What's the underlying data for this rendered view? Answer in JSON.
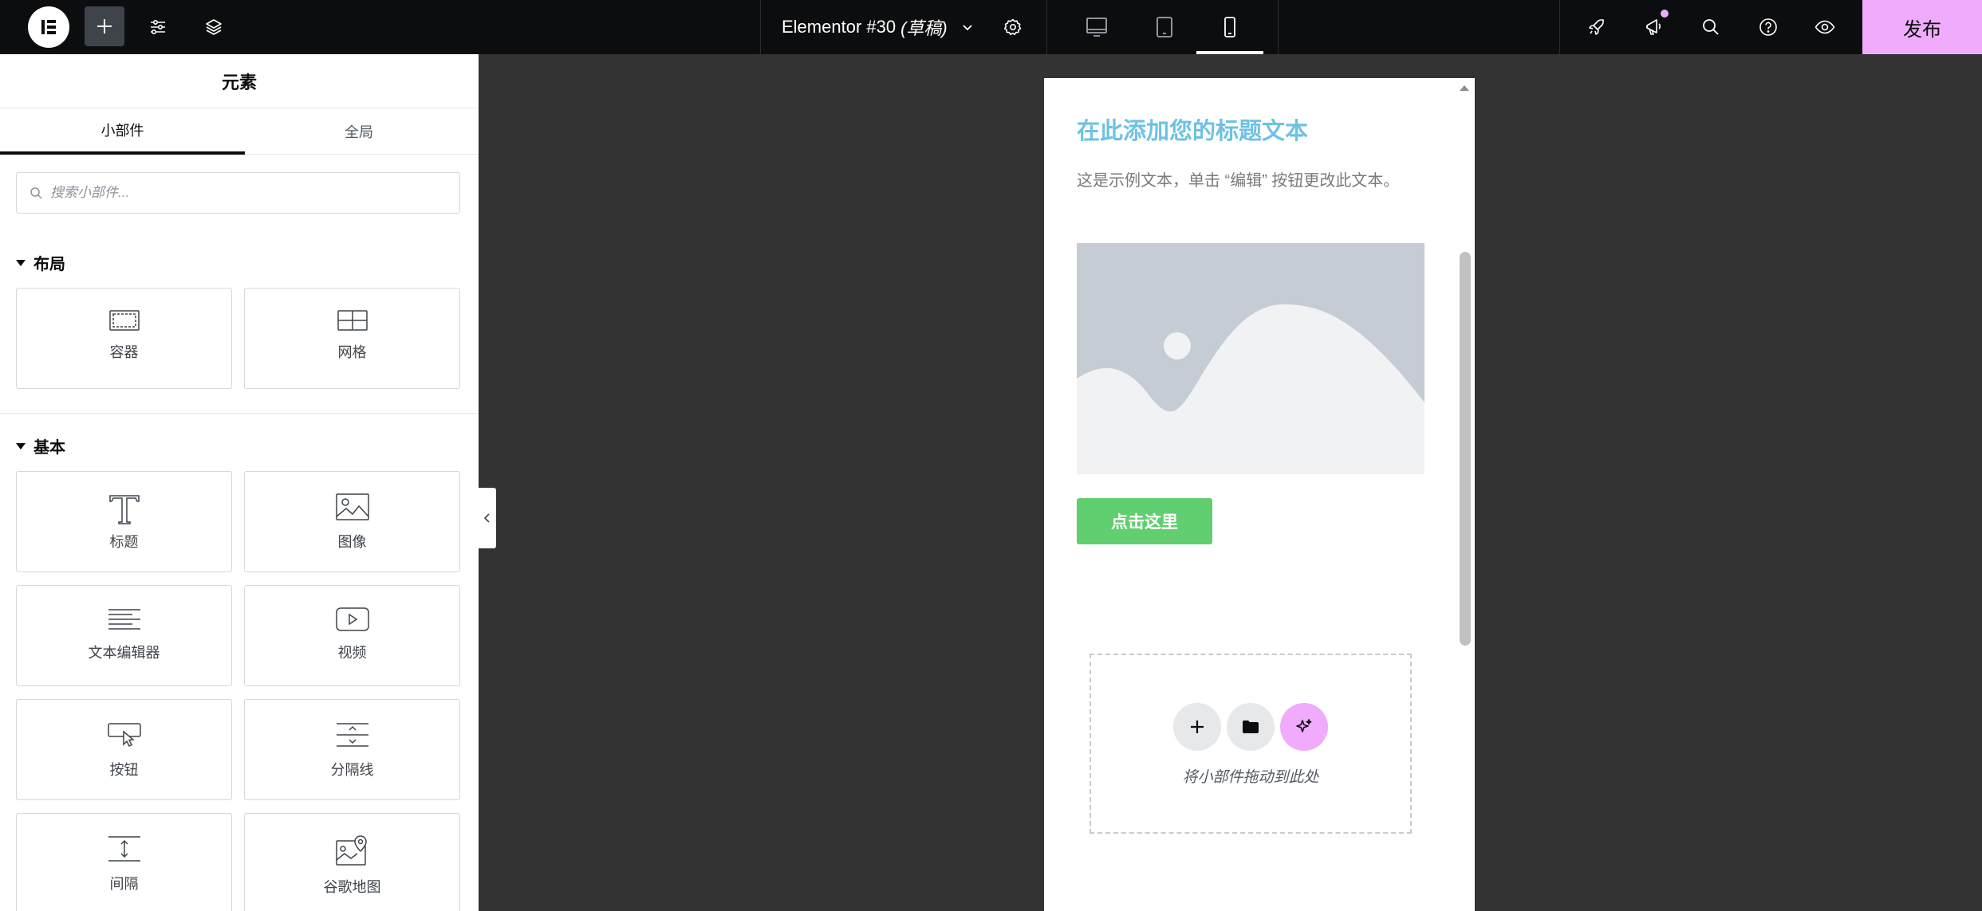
{
  "topbar": {
    "doc_title": "Elementor #30",
    "doc_status": "(草稿)",
    "publish_label": "发布"
  },
  "panel": {
    "title": "元素",
    "tabs": [
      {
        "label": "小部件",
        "active": true
      },
      {
        "label": "全局",
        "active": false
      }
    ],
    "search_placeholder": "搜索小部件...",
    "sections": [
      {
        "title": "布局",
        "widgets": [
          "容器",
          "网格"
        ]
      },
      {
        "title": "基本",
        "widgets": [
          "标题",
          "图像",
          "文本编辑器",
          "视频",
          "按钮",
          "分隔线",
          "间隔",
          "谷歌地图"
        ]
      }
    ]
  },
  "canvas": {
    "heading": "在此添加您的标题文本",
    "paragraph": "这是示例文本，单击 “编辑” 按钮更改此文本。",
    "button_label": "点击这里",
    "dropzone_text": "将小部件拖动到此处"
  },
  "colors": {
    "accent": "#f0abfc",
    "heading": "#6ec1e4",
    "button": "#61ce70",
    "topbar": "#0c0d0e",
    "canvas_bg": "#333334"
  }
}
